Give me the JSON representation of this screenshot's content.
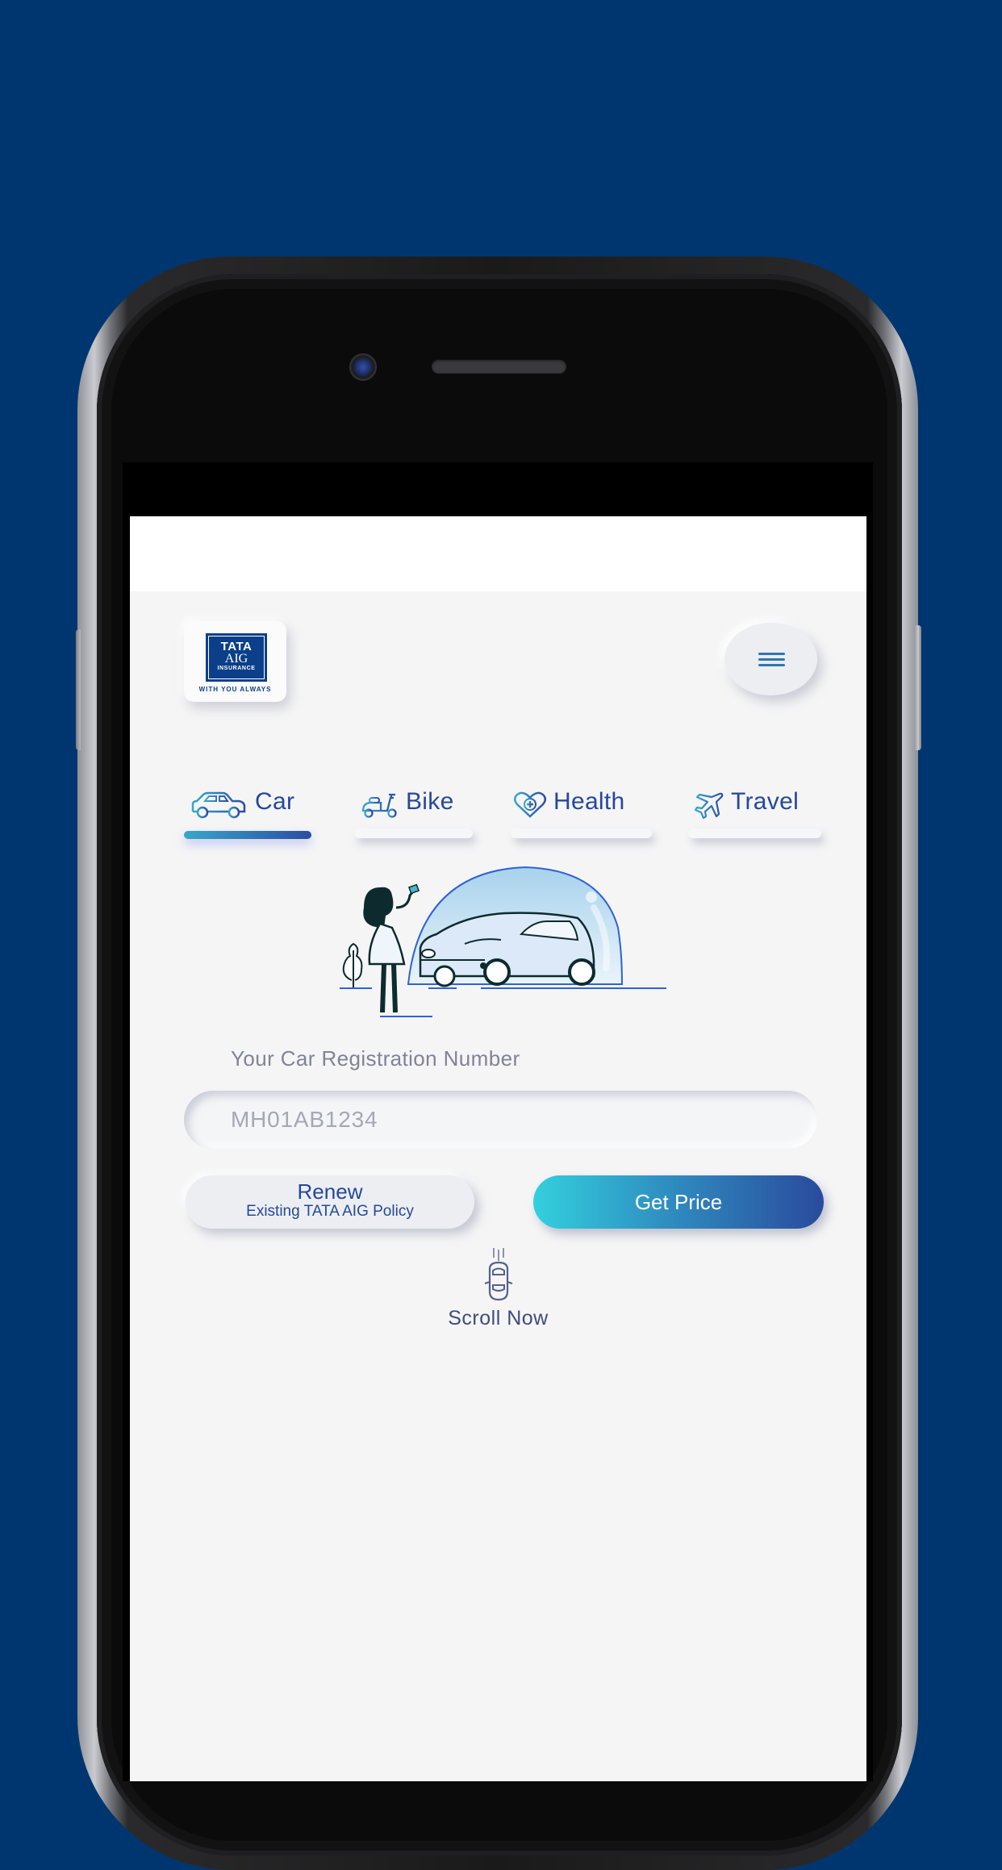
{
  "brand": {
    "logo_line1": "TATA",
    "logo_line2": "AIG",
    "logo_line3": "INSURANCE",
    "tagline": "WITH YOU ALWAYS"
  },
  "header": {
    "menu_icon": "hamburger-menu-icon"
  },
  "tabs": [
    {
      "label": "Car",
      "icon": "car-icon",
      "active": true
    },
    {
      "label": "Bike",
      "icon": "scooter-icon",
      "active": false
    },
    {
      "label": "Health",
      "icon": "heart-plus-icon",
      "active": false
    },
    {
      "label": "Travel",
      "icon": "airplane-icon",
      "active": false
    }
  ],
  "illustration": {
    "description": "woman-with-phone-and-car-under-dome"
  },
  "form": {
    "label": "Your Car Registration Number",
    "placeholder": "MH01AB1234",
    "value": ""
  },
  "actions": {
    "renew_title": "Renew",
    "renew_subtitle": "Existing TATA AIG Policy",
    "get_price": "Get Price"
  },
  "scroll": {
    "label": "Scroll Now",
    "icon": "car-top-view-icon"
  },
  "colors": {
    "background": "#00366f",
    "brand_blue": "#0b3f8a",
    "text_blue": "#26489a",
    "accent_cyan": "#33d0de",
    "screen_bg": "#f5f5f6"
  }
}
